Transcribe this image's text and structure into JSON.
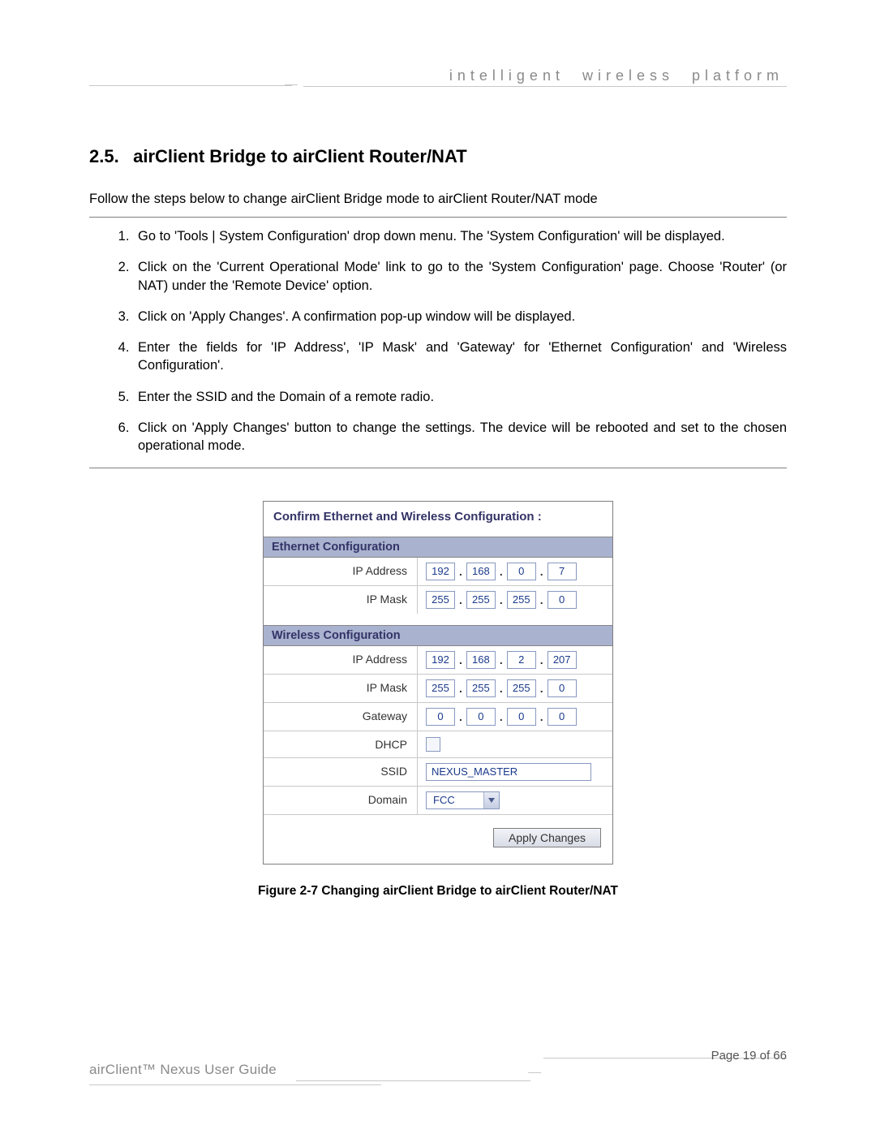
{
  "header": {
    "tagline": "intelligent  wireless  platform"
  },
  "section": {
    "number": "2.5.",
    "title": "airClient Bridge to airClient Router/NAT",
    "intro": "Follow the steps below to change airClient Bridge mode to airClient Router/NAT mode",
    "steps": [
      "Go to 'Tools | System Configuration' drop down menu. The 'System Configuration' will be displayed.",
      "Click on the 'Current Operational Mode' link to go to the 'System Configuration' page. Choose 'Router' (or NAT) under the 'Remote Device' option.",
      "Click on 'Apply Changes'.  A confirmation pop-up window will be displayed.",
      "Enter the fields for 'IP Address', 'IP Mask' and 'Gateway' for 'Ethernet Configuration' and 'Wireless Configuration'.",
      "Enter the SSID and the Domain of a remote radio.",
      "Click on 'Apply Changes' button to change the settings. The device will be rebooted and set to the chosen operational mode."
    ]
  },
  "figure": {
    "panel_title": "Confirm Ethernet and Wireless Configuration :",
    "ethernet": {
      "header": "Ethernet Configuration",
      "ip_label": "IP Address",
      "ip": [
        "192",
        "168",
        "0",
        "7"
      ],
      "mask_label": "IP Mask",
      "mask": [
        "255",
        "255",
        "255",
        "0"
      ]
    },
    "wireless": {
      "header": "Wireless Configuration",
      "ip_label": "IP Address",
      "ip": [
        "192",
        "168",
        "2",
        "207"
      ],
      "mask_label": "IP Mask",
      "mask": [
        "255",
        "255",
        "255",
        "0"
      ],
      "gateway_label": "Gateway",
      "gateway": [
        "0",
        "0",
        "0",
        "0"
      ],
      "dhcp_label": "DHCP",
      "dhcp_checked": false,
      "ssid_label": "SSID",
      "ssid": "NEXUS_MASTER",
      "domain_label": "Domain",
      "domain": "FCC"
    },
    "apply_label": "Apply Changes",
    "caption": "Figure 2-7 Changing airClient Bridge to airClient Router/NAT"
  },
  "footer": {
    "guide": "airClient™ Nexus User Guide",
    "page": "Page 19 of 66"
  }
}
